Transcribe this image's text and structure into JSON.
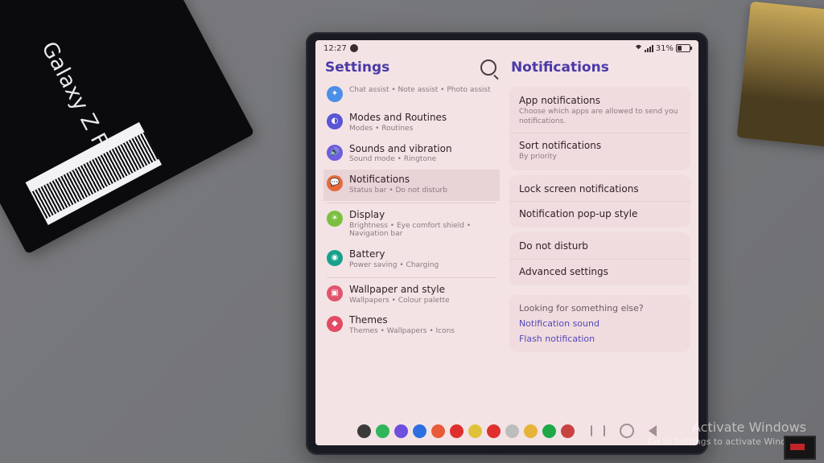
{
  "product_box_text": "Galaxy Z Fold6",
  "watermark": {
    "line1": "Activate Windows",
    "line2": "Go to Settings to activate Windows."
  },
  "status_bar": {
    "time": "12:27",
    "battery_text": "31%"
  },
  "left_pane": {
    "title": "Settings",
    "items": [
      {
        "icon_color": "#4c8fe8",
        "icon_glyph": "✦",
        "title": "Chat assist  •  Note assist  •  Photo assist",
        "subtitle": "",
        "title_is_sub": true
      },
      {
        "icon_color": "#5a55d6",
        "icon_glyph": "◐",
        "title": "Modes and Routines",
        "subtitle": "Modes  •  Routines"
      },
      {
        "icon_color": "#6d5de0",
        "icon_glyph": "🔊",
        "title": "Sounds and vibration",
        "subtitle": "Sound mode  •  Ringtone"
      },
      {
        "icon_color": "#e66a3c",
        "icon_glyph": "💬",
        "title": "Notifications",
        "subtitle": "Status bar  •  Do not disturb",
        "selected": true,
        "sep_after": true
      },
      {
        "icon_color": "#7bbf3f",
        "icon_glyph": "☀",
        "title": "Display",
        "subtitle": "Brightness  •  Eye comfort shield  •  Navigation bar"
      },
      {
        "icon_color": "#17a18b",
        "icon_glyph": "◉",
        "title": "Battery",
        "subtitle": "Power saving  •  Charging",
        "sep_after": true
      },
      {
        "icon_color": "#e0556e",
        "icon_glyph": "▣",
        "title": "Wallpaper and style",
        "subtitle": "Wallpapers  •  Colour palette"
      },
      {
        "icon_color": "#e24b62",
        "icon_glyph": "◆",
        "title": "Themes",
        "subtitle": "Themes  •  Wallpapers  •  Icons"
      }
    ]
  },
  "right_pane": {
    "title": "Notifications",
    "cards": [
      [
        {
          "title": "App notifications",
          "subtitle": "Choose which apps are allowed to send you notifications."
        },
        {
          "title": "Sort notifications",
          "subtitle": "By priority"
        }
      ],
      [
        {
          "title": "Lock screen notifications"
        },
        {
          "title": "Notification pop-up style"
        }
      ],
      [
        {
          "title": "Do not disturb"
        },
        {
          "title": "Advanced settings"
        }
      ]
    ],
    "looking": {
      "heading": "Looking for something else?",
      "links": [
        "Notification sound",
        "Flash notification"
      ]
    }
  },
  "dock_colors": [
    "#3a3a3a",
    "#2fb65a",
    "#6e4fe0",
    "#2d6fe0",
    "#e85a3a",
    "#e02f2f",
    "#e0c23a",
    "#e02f2f",
    "#bdbdbd",
    "#e6b23a",
    "#1fa84a",
    "#c94242"
  ]
}
